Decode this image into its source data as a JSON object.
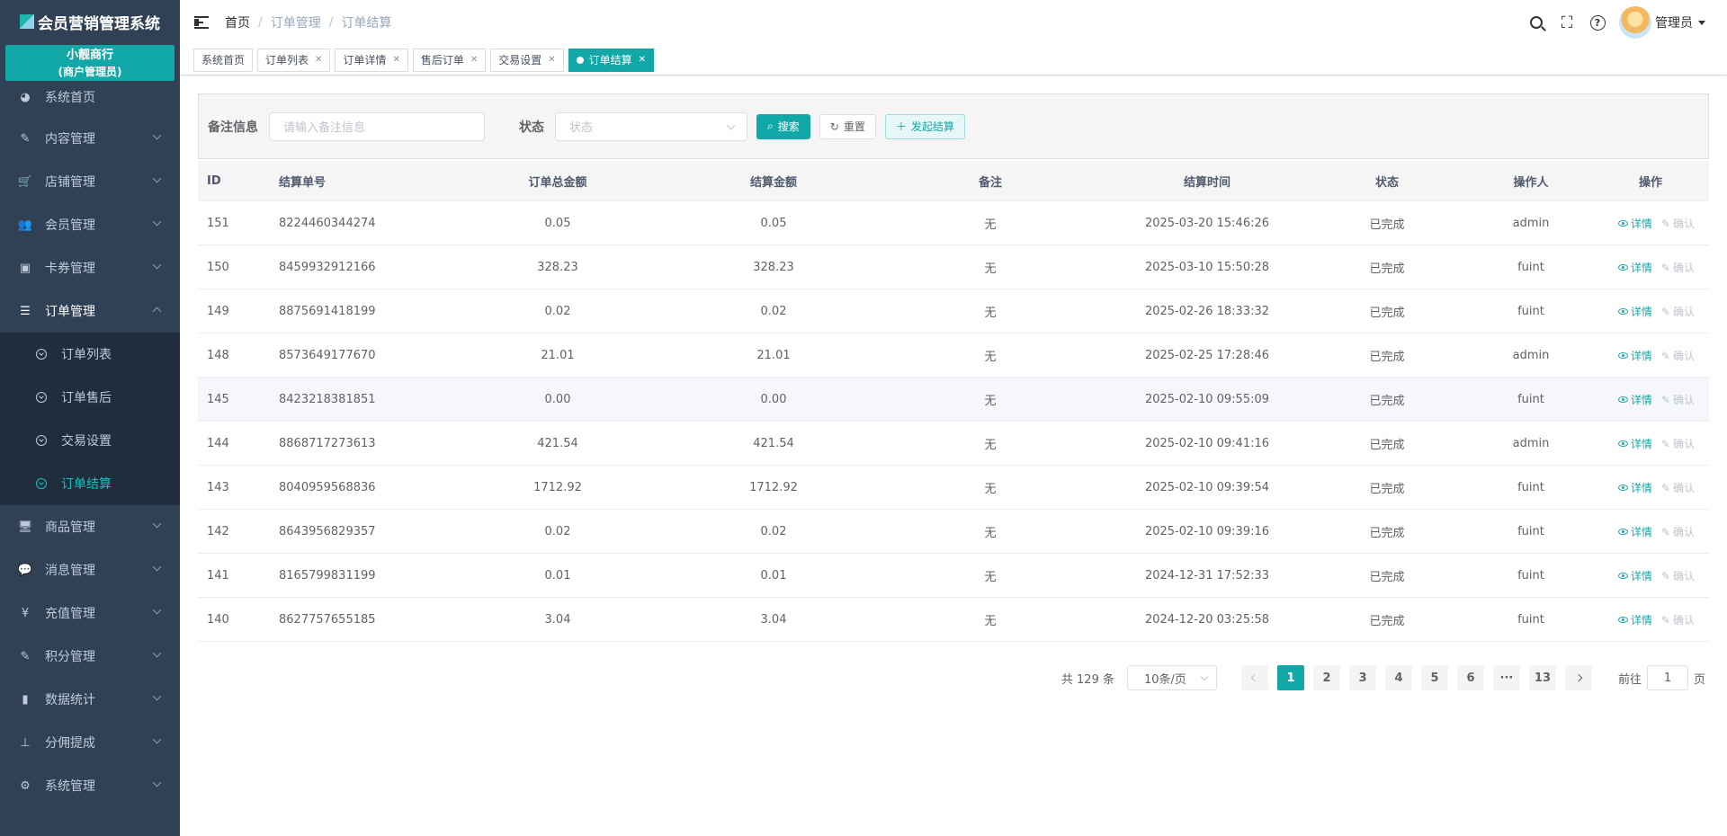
{
  "app": {
    "logo_text": "会员营销管理系统",
    "merchant_name": "小靓商行",
    "merchant_role": "(商户管理员)"
  },
  "sidebar": {
    "items": [
      {
        "label": "系统首页",
        "icon": "dashboard-icon"
      },
      {
        "label": "内容管理",
        "icon": "edit-icon"
      },
      {
        "label": "店铺管理",
        "icon": "cart-icon"
      },
      {
        "label": "会员管理",
        "icon": "peoples-icon"
      },
      {
        "label": "卡券管理",
        "icon": "coupon-icon"
      },
      {
        "label": "订单管理",
        "icon": "list-icon"
      }
    ],
    "order_sub": [
      {
        "label": "订单列表"
      },
      {
        "label": "订单售后"
      },
      {
        "label": "交易设置"
      },
      {
        "label": "订单结算"
      }
    ],
    "items_after": [
      {
        "label": "商品管理",
        "icon": "monitor-icon"
      },
      {
        "label": "消息管理",
        "icon": "message-icon"
      },
      {
        "label": "充值管理",
        "icon": "yen-icon"
      },
      {
        "label": "积分管理",
        "icon": "edit-icon"
      },
      {
        "label": "数据统计",
        "icon": "chart-icon"
      },
      {
        "label": "分佣提成",
        "icon": "tree-icon"
      },
      {
        "label": "系统管理",
        "icon": "gear-icon"
      }
    ]
  },
  "header": {
    "breadcrumb": [
      "首页",
      "订单管理",
      "订单结算"
    ],
    "user_name": "管理员"
  },
  "tags": [
    {
      "label": "系统首页"
    },
    {
      "label": "订单列表"
    },
    {
      "label": "订单详情"
    },
    {
      "label": "售后订单"
    },
    {
      "label": "交易设置"
    },
    {
      "label": "订单结算"
    }
  ],
  "search": {
    "remark_label": "备注信息",
    "remark_placeholder": "请输入备注信息",
    "status_label": "状态",
    "status_placeholder": "状态",
    "search_btn": "搜索",
    "reset_btn": "重置",
    "settle_btn": "发起结算"
  },
  "table": {
    "columns": [
      "ID",
      "结算单号",
      "订单总金额",
      "结算金额",
      "备注",
      "结算时间",
      "状态",
      "操作人",
      "操作"
    ],
    "detail_label": "详情",
    "confirm_label": "确认",
    "rows": [
      {
        "id": "151",
        "no": "8224460344274",
        "total": "0.05",
        "amount": "0.05",
        "remark": "无",
        "time": "2025-03-20 15:46:26",
        "status": "已完成",
        "operator": "admin"
      },
      {
        "id": "150",
        "no": "8459932912166",
        "total": "328.23",
        "amount": "328.23",
        "remark": "无",
        "time": "2025-03-10 15:50:28",
        "status": "已完成",
        "operator": "fuint"
      },
      {
        "id": "149",
        "no": "8875691418199",
        "total": "0.02",
        "amount": "0.02",
        "remark": "无",
        "time": "2025-02-26 18:33:32",
        "status": "已完成",
        "operator": "fuint"
      },
      {
        "id": "148",
        "no": "8573649177670",
        "total": "21.01",
        "amount": "21.01",
        "remark": "无",
        "time": "2025-02-25 17:28:46",
        "status": "已完成",
        "operator": "admin"
      },
      {
        "id": "145",
        "no": "8423218381851",
        "total": "0.00",
        "amount": "0.00",
        "remark": "无",
        "time": "2025-02-10 09:55:09",
        "status": "已完成",
        "operator": "fuint"
      },
      {
        "id": "144",
        "no": "8868717273613",
        "total": "421.54",
        "amount": "421.54",
        "remark": "无",
        "time": "2025-02-10 09:41:16",
        "status": "已完成",
        "operator": "admin"
      },
      {
        "id": "143",
        "no": "8040959568836",
        "total": "1712.92",
        "amount": "1712.92",
        "remark": "无",
        "time": "2025-02-10 09:39:54",
        "status": "已完成",
        "operator": "fuint"
      },
      {
        "id": "142",
        "no": "8643956829357",
        "total": "0.02",
        "amount": "0.02",
        "remark": "无",
        "time": "2025-02-10 09:39:16",
        "status": "已完成",
        "operator": "fuint"
      },
      {
        "id": "141",
        "no": "8165799831199",
        "total": "0.01",
        "amount": "0.01",
        "remark": "无",
        "time": "2024-12-31 17:52:33",
        "status": "已完成",
        "operator": "fuint"
      },
      {
        "id": "140",
        "no": "8627757655185",
        "total": "3.04",
        "amount": "3.04",
        "remark": "无",
        "time": "2024-12-20 03:25:58",
        "status": "已完成",
        "operator": "fuint"
      }
    ]
  },
  "pagination": {
    "total_text": "共 129 条",
    "page_size": "10条/页",
    "pages": [
      "1",
      "2",
      "3",
      "4",
      "5",
      "6",
      "···",
      "13"
    ],
    "current": "1",
    "goto_prefix": "前往",
    "goto_value": "1",
    "goto_suffix": "页"
  },
  "colors": {
    "primary": "#13a8a8",
    "sidebar_bg": "#304156",
    "submenu_bg": "#1f2d3d"
  }
}
